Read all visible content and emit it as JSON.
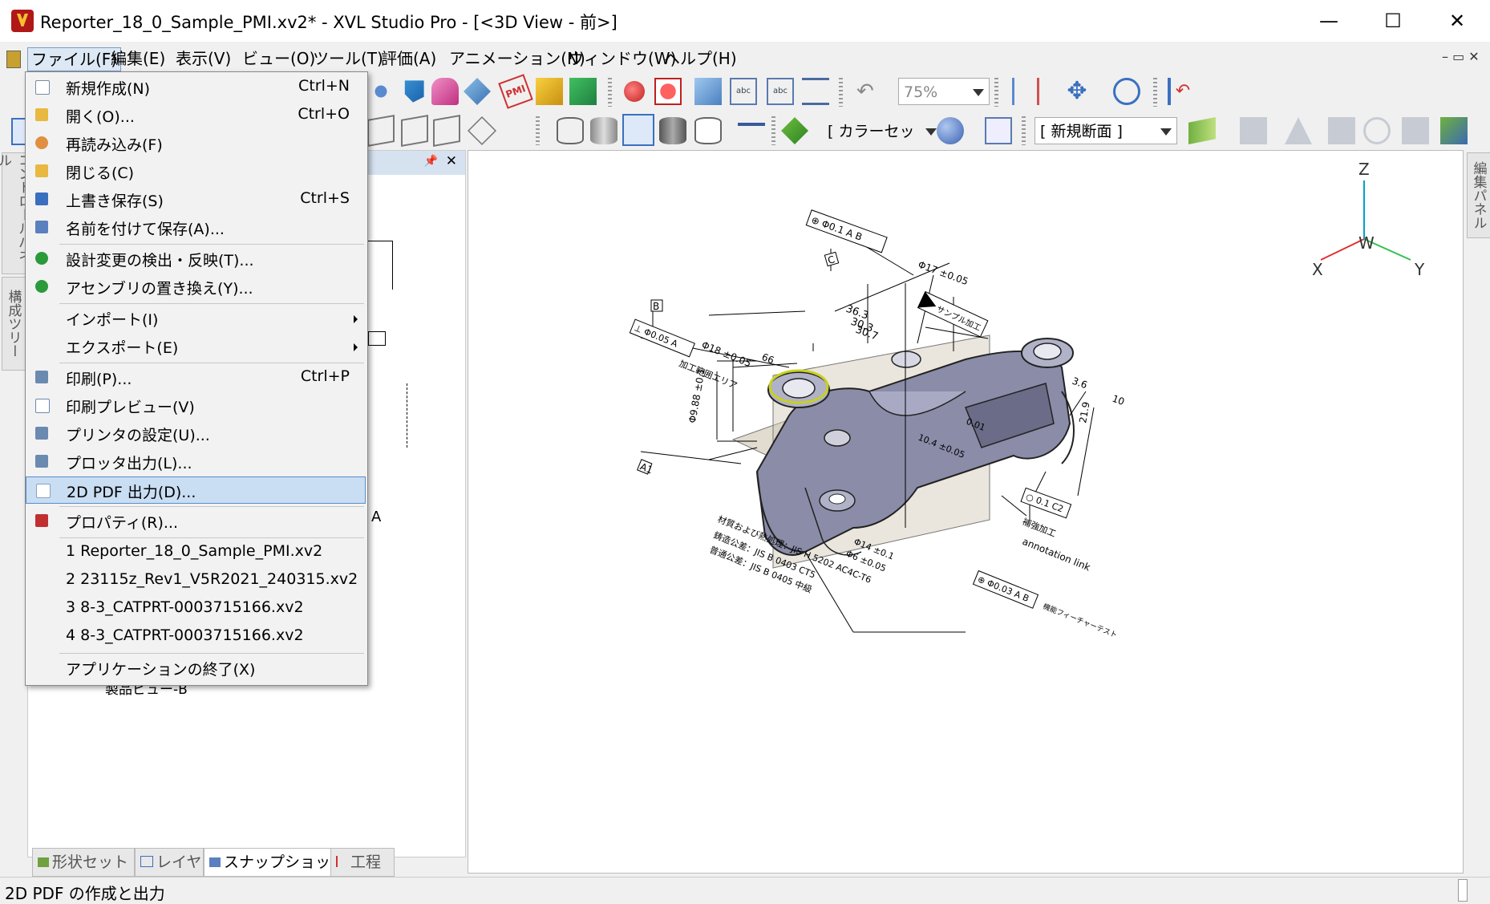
{
  "window": {
    "title": "Reporter_18_0_Sample_PMI.xv2* - XVL Studio Pro - [<3D View - 前>]",
    "minimize": "—",
    "maximize": "☐",
    "close": "✕"
  },
  "menubar": [
    {
      "label": "ファイル(F)"
    },
    {
      "label": "編集(E)"
    },
    {
      "label": "表示(V)"
    },
    {
      "label": "ビュー(O)"
    },
    {
      "label": "ツール(T)"
    },
    {
      "label": "評価(A)"
    },
    {
      "label": "アニメーション(N)"
    },
    {
      "label": "ウィンドウ(W)"
    },
    {
      "label": "ヘルプ(H)"
    }
  ],
  "toolbar": {
    "zoom": "75%",
    "colorset": "[ カラーセット ]",
    "section": "[ 新規断面 ]"
  },
  "side_tabs": {
    "control_panel": "コントロールパネル",
    "structure_tree": "構成ツリー",
    "edit_panel": "編集パネル"
  },
  "panel": {
    "tree_fragment_a": "A",
    "tree_item": "製品ビュー-B",
    "bottom_tabs": [
      {
        "label": "形状セット"
      },
      {
        "label": "レイヤ"
      },
      {
        "label": "スナップショット"
      },
      {
        "label": "工程"
      }
    ]
  },
  "file_menu": {
    "items": [
      {
        "label": "新規作成(N)",
        "shortcut": "Ctrl+N",
        "icon": "new-file-icon",
        "color": "#e8e8f0"
      },
      {
        "label": "開く(O)...",
        "shortcut": "Ctrl+O",
        "icon": "open-folder-icon",
        "color": "#e8b840"
      },
      {
        "label": "再読み込み(F)",
        "shortcut": "",
        "icon": "reload-icon",
        "color": "#e09040"
      },
      {
        "label": "閉じる(C)",
        "shortcut": "",
        "icon": "close-folder-icon",
        "color": "#e8b840"
      },
      {
        "label": "上書き保存(S)",
        "shortcut": "Ctrl+S",
        "icon": "save-icon",
        "color": "#3a6fc0"
      },
      {
        "label": "名前を付けて保存(A)...",
        "shortcut": "",
        "icon": "save-as-icon",
        "color": "#5a80c0"
      },
      {
        "label": "設計変更の検出・反映(T)...",
        "shortcut": "",
        "icon": "design-change-icon",
        "color": "#2a9a3a"
      },
      {
        "label": "アセンブリの置き換え(Y)...",
        "shortcut": "",
        "icon": "replace-assembly-icon",
        "color": "#2a9a3a"
      },
      {
        "label": "インポート(I)",
        "shortcut": "",
        "icon": "",
        "color": ""
      },
      {
        "label": "エクスポート(E)",
        "shortcut": "",
        "icon": "",
        "color": ""
      },
      {
        "label": "印刷(P)...",
        "shortcut": "Ctrl+P",
        "icon": "print-icon",
        "color": "#6a8ab0"
      },
      {
        "label": "印刷プレビュー(V)",
        "shortcut": "",
        "icon": "print-preview-icon",
        "color": "#6a8ab0"
      },
      {
        "label": "プリンタの設定(U)...",
        "shortcut": "",
        "icon": "printer-setup-icon",
        "color": "#6a8ab0"
      },
      {
        "label": "プロッタ出力(L)...",
        "shortcut": "",
        "icon": "plotter-icon",
        "color": "#6a8ab0"
      },
      {
        "label": "2D PDF 出力(D)...",
        "shortcut": "",
        "icon": "pdf-export-icon",
        "color": "#8aa0c0"
      },
      {
        "label": "プロパティ(R)...",
        "shortcut": "",
        "icon": "properties-icon",
        "color": "#c03030"
      },
      {
        "label": "1 Reporter_18_0_Sample_PMI.xv2",
        "shortcut": "",
        "icon": "",
        "color": ""
      },
      {
        "label": "2 23115z_Rev1_V5R2021_240315.xv2",
        "shortcut": "",
        "icon": "",
        "color": ""
      },
      {
        "label": "3 8-3_CATPRT-0003715166.xv2",
        "shortcut": "",
        "icon": "",
        "color": ""
      },
      {
        "label": "4 8-3_CATPRT-0003715166.xv2",
        "shortcut": "",
        "icon": "",
        "color": ""
      },
      {
        "label": "アプリケーションの終了(X)",
        "shortcut": "",
        "icon": "",
        "color": ""
      }
    ]
  },
  "viewport": {
    "axis_z": "Z",
    "axis_w": "W",
    "axis_x": "X",
    "axis_y": "Y",
    "pmi": {
      "datum_b": "B",
      "datum_c": "C",
      "fcf_top": "⊕ Φ0.1 A B",
      "dia17": "Φ17 ±0.05",
      "dim363": "36.3",
      "dim_a": "30.3",
      "dim_b": "30.7",
      "note_sample": "サンプル加工",
      "fcf_left": "⊥ Φ0.05 A",
      "dia18": "Φ18 ±0.05",
      "note_area": "加工範囲エリア",
      "dim66": "66",
      "dim3": "3.6",
      "dim10": "10",
      "dim219": "21.9",
      "dim_vert": "Φ9.88 ±0.1",
      "datum_a1": "A1",
      "dim_mid": "10.4 ±0.05",
      "dim_mid2": "0.01",
      "fcf_small": "○ 0.1 C2",
      "note_hole": "補強加工",
      "note_annotation": "annotation link",
      "dim14": "Φ14 ±0.1",
      "dim6": "Φ6 ±0.05",
      "note_material": "材質および熱処理：JIS H 5202 AC4C-T6",
      "note_tol1": "鋳造公差：JIS B 0403 CT5",
      "note_tol2": "普通公差：JIS B 0405 中級",
      "fcf_bottom": "⊕ Φ0.03 A B",
      "note_feature": "機能フィーチャーテスト"
    }
  },
  "status": {
    "text": "2D PDF の作成と出力"
  }
}
